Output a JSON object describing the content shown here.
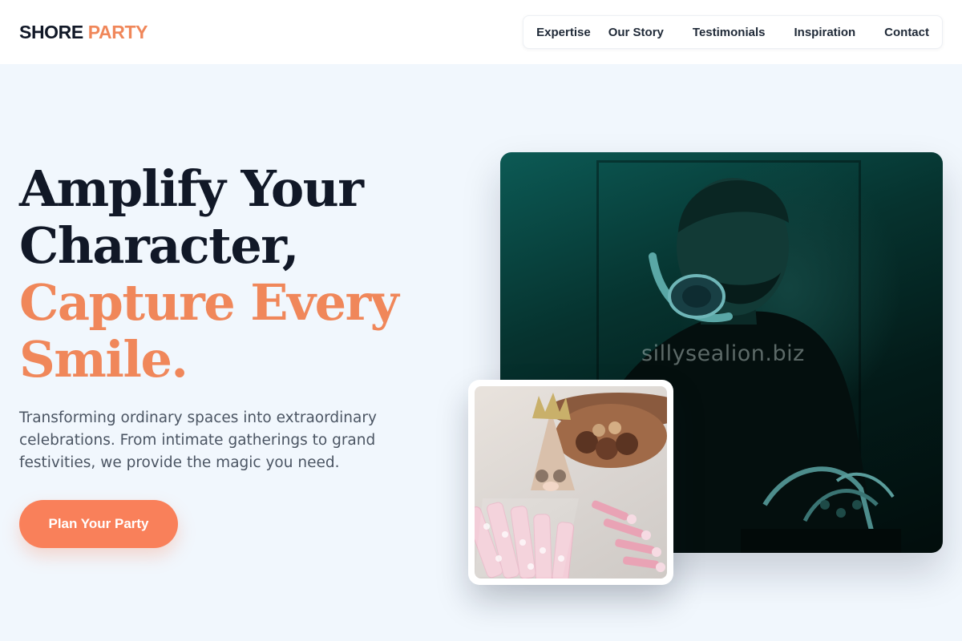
{
  "brand": {
    "name_part1": "SHORE",
    "name_part2": "PARTY"
  },
  "nav": {
    "items": [
      "Expertise",
      "Our Story",
      "Testimonials",
      "Inspiration",
      "Contact"
    ]
  },
  "hero": {
    "title_line1": "Amplify Your",
    "title_line2": "Character,",
    "title_line3": "Capture Every",
    "title_line4": "Smile.",
    "subtitle": "Transforming ordinary spaces into extraordinary celebrations. From intimate gatherings to grand festivities, we provide the magic you need.",
    "cta_label": "Plan Your Party"
  },
  "media": {
    "main_photo_watermark": "sillysealion.biz"
  },
  "colors": {
    "accent": "#f0875a",
    "cta": "#f9805a",
    "heading": "#111827",
    "background": "#f1f7fd"
  }
}
